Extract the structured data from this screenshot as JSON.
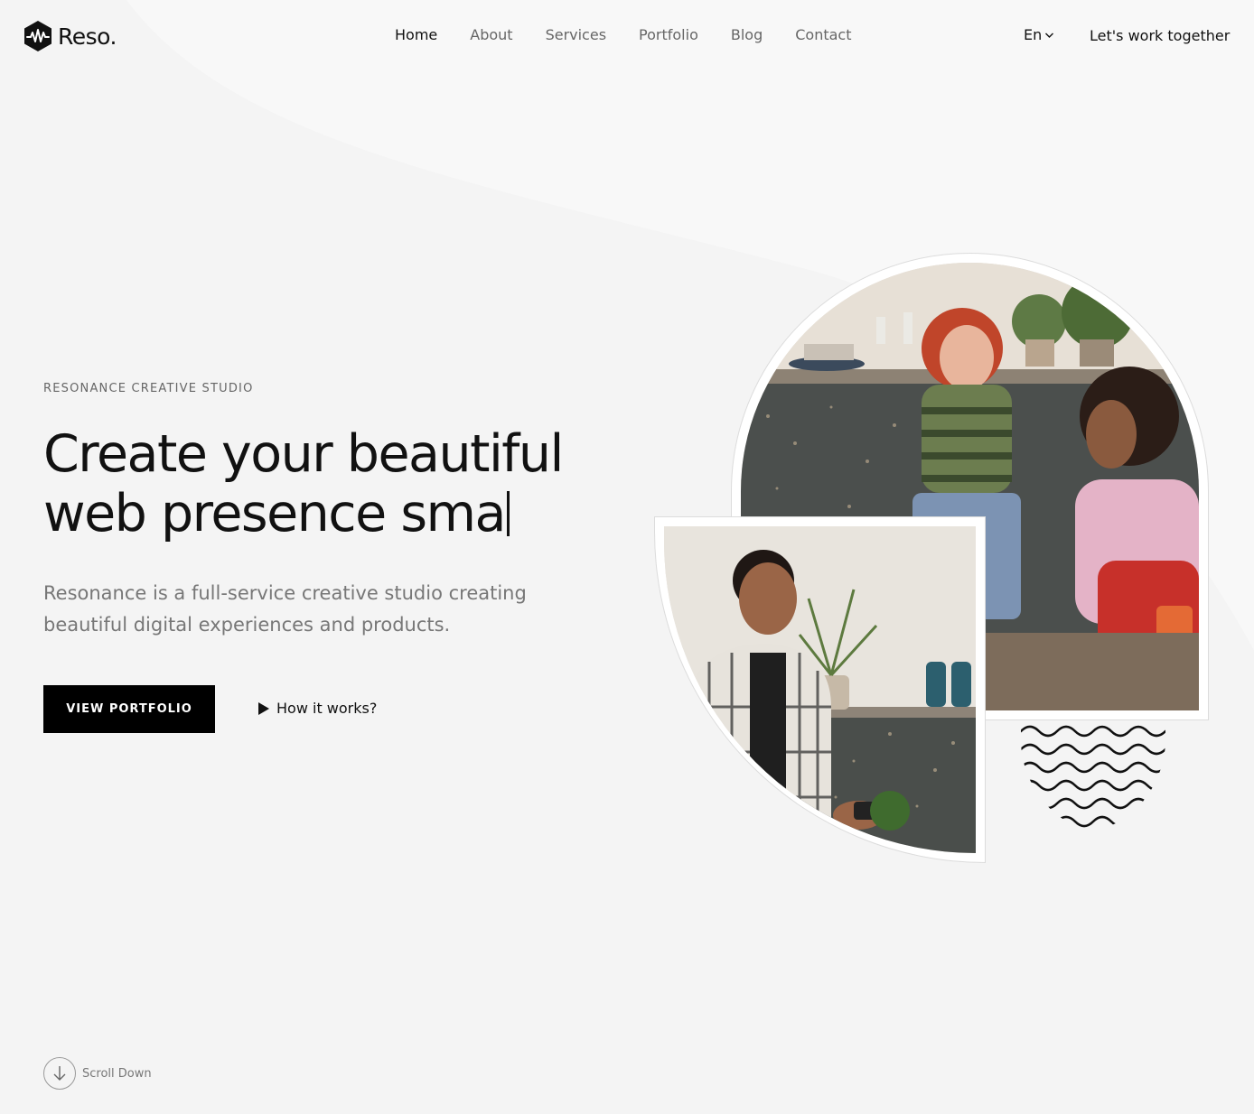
{
  "brand": {
    "name": "Reso."
  },
  "nav": {
    "items": [
      {
        "label": "Home",
        "active": true
      },
      {
        "label": "About"
      },
      {
        "label": "Services"
      },
      {
        "label": "Portfolio"
      },
      {
        "label": "Blog"
      },
      {
        "label": "Contact"
      }
    ],
    "language": "En",
    "cta": "Let's work together"
  },
  "hero": {
    "eyebrow": "RESONANCE CREATIVE STUDIO",
    "headline_line1": "Create your beautiful",
    "headline_line2": "web presence sma",
    "lede": "Resonance is a full-service creative studio creating beautiful digital experiences and products.",
    "primary_button": "VIEW PORTFOLIO",
    "secondary_link": "How it works?"
  },
  "scroll": {
    "label": "Scroll Down"
  },
  "icons": {
    "logo": "waveform-hexagon-icon",
    "language_caret": "chevron-down-icon",
    "play": "play-icon",
    "scroll": "arrow-down-icon",
    "decor": "wavy-lines-icon"
  },
  "colors": {
    "background": "#f6f6f6",
    "text": "#111111",
    "muted": "#777777",
    "button": "#000000"
  }
}
